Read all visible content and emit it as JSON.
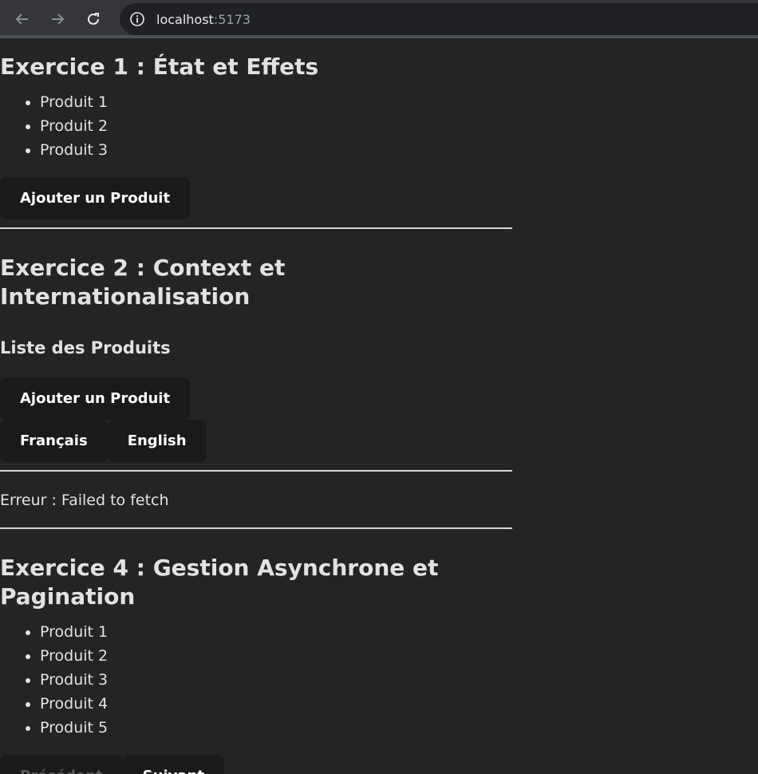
{
  "browser": {
    "url_host": "localhost",
    "url_port": ":5173"
  },
  "exercise1": {
    "title": "Exercice 1 : État et Effets",
    "items": [
      "Produit 1",
      "Produit 2",
      "Produit 3"
    ],
    "add_button": "Ajouter un Produit"
  },
  "exercise2": {
    "title": "Exercice 2 : Context et Internationalisation",
    "subtitle": "Liste des Produits",
    "add_button": "Ajouter un Produit",
    "lang_fr": "Français",
    "lang_en": "English"
  },
  "exercise3": {
    "error": "Erreur : Failed to fetch"
  },
  "exercise4": {
    "title": "Exercice 4 : Gestion Asynchrone et Pagination",
    "items": [
      "Produit 1",
      "Produit 2",
      "Produit 3",
      "Produit 4",
      "Produit 5"
    ],
    "prev_button": "Précédent",
    "next_button": "Suivant"
  }
}
